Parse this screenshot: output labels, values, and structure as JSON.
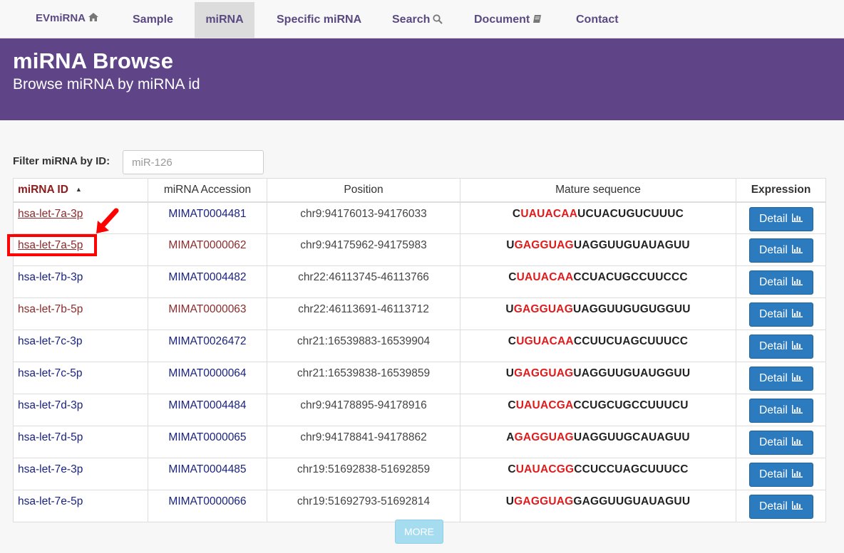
{
  "nav": {
    "brand": "EVmiRNA",
    "items": [
      {
        "label": "Sample"
      },
      {
        "label": "miRNA"
      },
      {
        "label": "Specific miRNA"
      },
      {
        "label": "Search"
      },
      {
        "label": "Document"
      },
      {
        "label": "Contact"
      }
    ]
  },
  "banner": {
    "title": "miRNA Browse",
    "subtitle": "Browse miRNA by miRNA id"
  },
  "filter": {
    "label": "Filter miRNA by ID:",
    "placeholder": "miR-126"
  },
  "table": {
    "headers": [
      "miRNA ID",
      "miRNA Accession",
      "Position",
      "Mature sequence",
      "Expression"
    ],
    "detail_label": "Detail",
    "rows": [
      {
        "id": "hsa-let-7a-3p",
        "accession": "MIMAT0004481",
        "position": "chr9:94176013-94176033",
        "seq_pre": "C",
        "seq_seed": "UAUACAA",
        "seq_post": "UCUACUGUCUUUC"
      },
      {
        "id": "hsa-let-7a-5p",
        "accession": "MIMAT0000062",
        "position": "chr9:94175962-94175983",
        "seq_pre": "U",
        "seq_seed": "GAGGUAG",
        "seq_post": "UAGGUUGUAUAGUU"
      },
      {
        "id": "hsa-let-7b-3p",
        "accession": "MIMAT0004482",
        "position": "chr22:46113745-46113766",
        "seq_pre": "C",
        "seq_seed": "UAUACAA",
        "seq_post": "CCUACUGCCUUCCC"
      },
      {
        "id": "hsa-let-7b-5p",
        "accession": "MIMAT0000063",
        "position": "chr22:46113691-46113712",
        "seq_pre": "U",
        "seq_seed": "GAGGUAG",
        "seq_post": "UAGGUUGUGUGGUU"
      },
      {
        "id": "hsa-let-7c-3p",
        "accession": "MIMAT0026472",
        "position": "chr21:16539883-16539904",
        "seq_pre": "C",
        "seq_seed": "UGUACAA",
        "seq_post": "CCUUCUAGCUUUCC"
      },
      {
        "id": "hsa-let-7c-5p",
        "accession": "MIMAT0000064",
        "position": "chr21:16539838-16539859",
        "seq_pre": "U",
        "seq_seed": "GAGGUAG",
        "seq_post": "UAGGUUGUAUGGUU"
      },
      {
        "id": "hsa-let-7d-3p",
        "accession": "MIMAT0004484",
        "position": "chr9:94178895-94178916",
        "seq_pre": "C",
        "seq_seed": "UAUACGA",
        "seq_post": "CCUGCUGCCUUUCU"
      },
      {
        "id": "hsa-let-7d-5p",
        "accession": "MIMAT0000065",
        "position": "chr9:94178841-94178862",
        "seq_pre": "A",
        "seq_seed": "GAGGUAG",
        "seq_post": "UAGGUUGCAUAGUU"
      },
      {
        "id": "hsa-let-7e-3p",
        "accession": "MIMAT0004485",
        "position": "chr19:51692838-51692859",
        "seq_pre": "C",
        "seq_seed": "UAUACGG",
        "seq_post": "CCUCCUAGCUUUCC"
      },
      {
        "id": "hsa-let-7e-5p",
        "accession": "MIMAT0000066",
        "position": "chr19:51692793-51692814",
        "seq_pre": "U",
        "seq_seed": "GAGGUAG",
        "seq_post": "GAGGUUGUAUAGUU"
      }
    ]
  },
  "more_label": "MORE",
  "colors": {
    "banner": "#5f4588",
    "seed": "#e01b1b",
    "button": "#2c7bbf",
    "annotation": "#ff0000"
  }
}
